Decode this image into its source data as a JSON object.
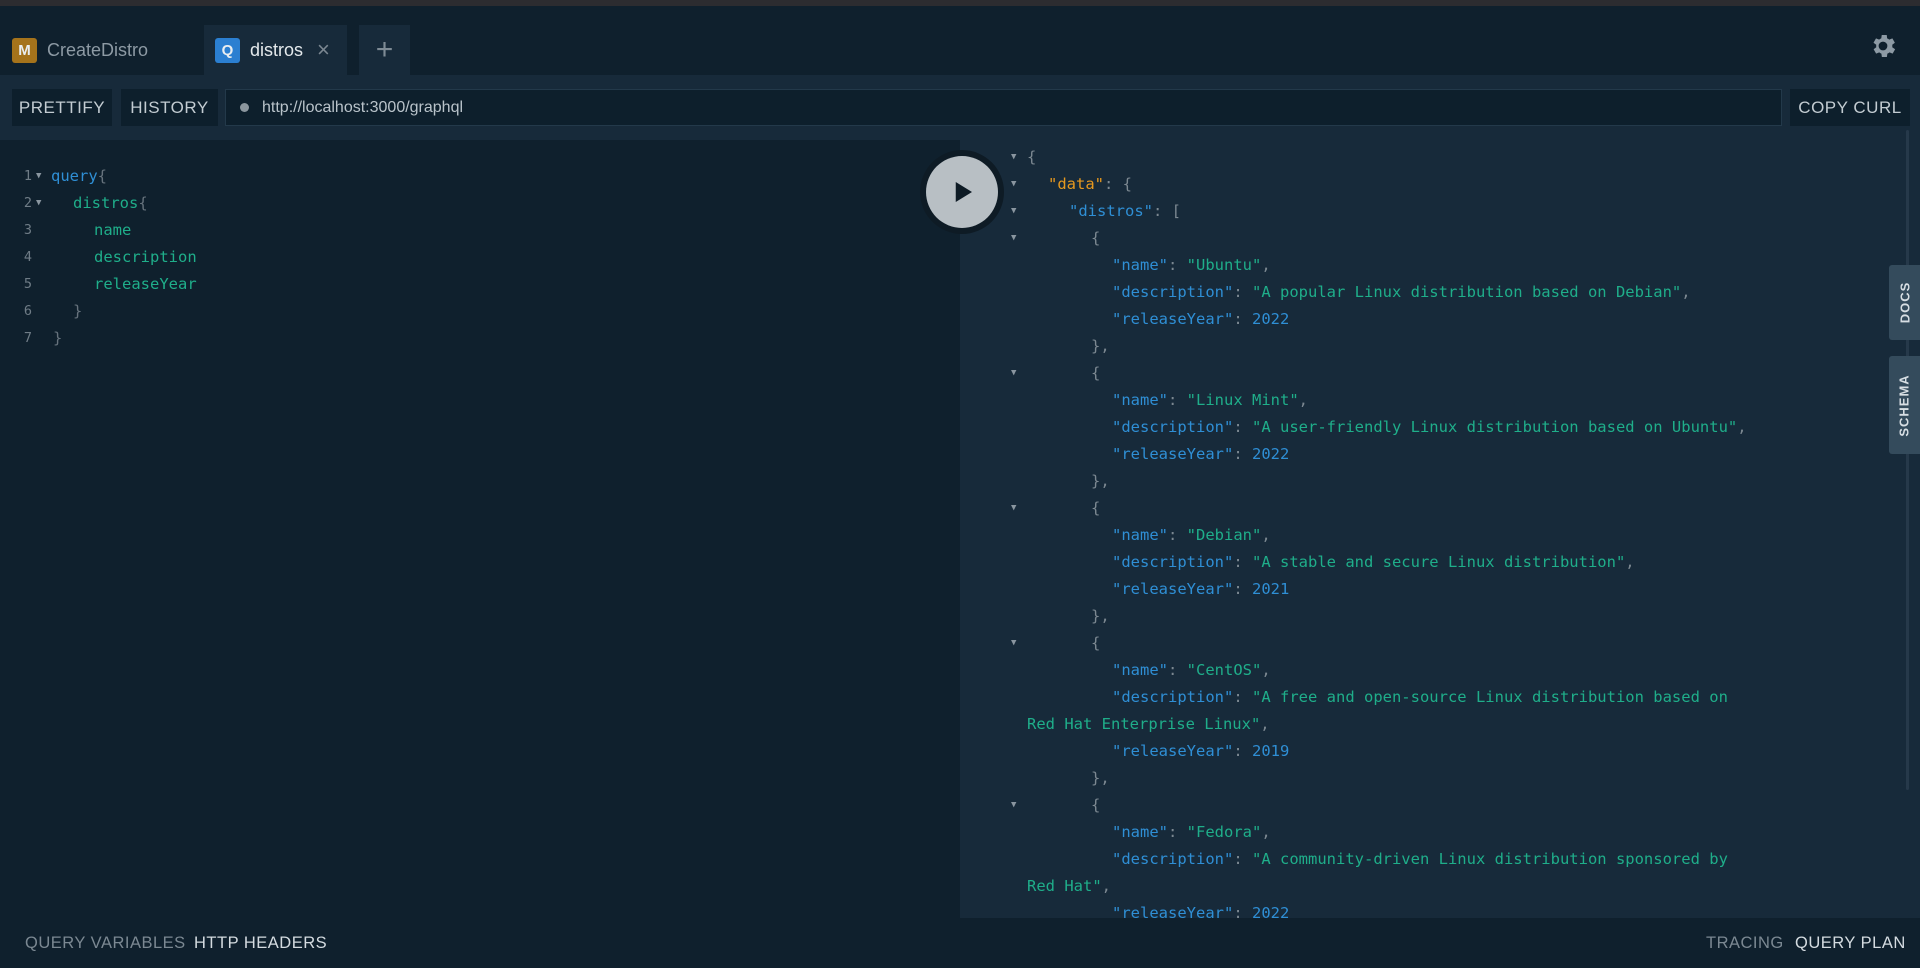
{
  "tabs": [
    {
      "badge": "M",
      "badge_color": "#a5731b",
      "label": "CreateDistro",
      "active": false
    },
    {
      "badge": "Q",
      "badge_color": "#2b7fd1",
      "label": "distros",
      "active": true,
      "close": "×"
    }
  ],
  "add_tab_label": "+",
  "toolbar": {
    "prettify": "PRETTIFY",
    "history": "HISTORY",
    "url": "http://localhost:3000/graphql",
    "copy_curl": "COPY CURL"
  },
  "query_lines": [
    {
      "n": "1",
      "fold": true
    },
    {
      "n": "2",
      "fold": true
    },
    {
      "n": "3",
      "fold": false
    },
    {
      "n": "4",
      "fold": false
    },
    {
      "n": "5",
      "fold": false
    },
    {
      "n": "6",
      "fold": false
    },
    {
      "n": "7",
      "fold": false
    }
  ],
  "query": {
    "keyword": "query",
    "root_field": "distros",
    "fields": [
      "name",
      "description",
      "releaseYear"
    ]
  },
  "result": {
    "data_key": "\"data\"",
    "distros_key": "\"distros\"",
    "keys": {
      "name": "\"name\"",
      "description": "\"description\"",
      "releaseYear": "\"releaseYear\""
    },
    "items": [
      {
        "name": "\"Ubuntu\"",
        "description": "\"A popular Linux distribution based on Debian\"",
        "releaseYear": "2022"
      },
      {
        "name": "\"Linux Mint\"",
        "description": "\"A user-friendly Linux distribution based on Ubuntu\"",
        "releaseYear": "2022"
      },
      {
        "name": "\"Debian\"",
        "description": "\"A stable and secure Linux distribution\"",
        "releaseYear": "2021"
      },
      {
        "name": "\"CentOS\"",
        "description_1": "\"A free and open-source Linux distribution based on",
        "description_2": "Red Hat Enterprise Linux\"",
        "releaseYear": "2019"
      },
      {
        "name": "\"Fedora\"",
        "description_1": "\"A community-driven Linux distribution sponsored by",
        "description_2": "Red Hat\"",
        "releaseYear": "2022"
      }
    ]
  },
  "side_tabs": {
    "docs": "DOCS",
    "schema": "SCHEMA"
  },
  "bottom": {
    "query_variables": "QUERY VARIABLES",
    "http_headers": "HTTP HEADERS",
    "tracing": "TRACING",
    "query_plan": "QUERY PLAN"
  },
  "colors": {
    "background": "#172a3a",
    "editor_bg": "#0f202d",
    "keyword": "#2f8fd5",
    "string": "#1fae8a",
    "data_key": "#e6981f"
  }
}
